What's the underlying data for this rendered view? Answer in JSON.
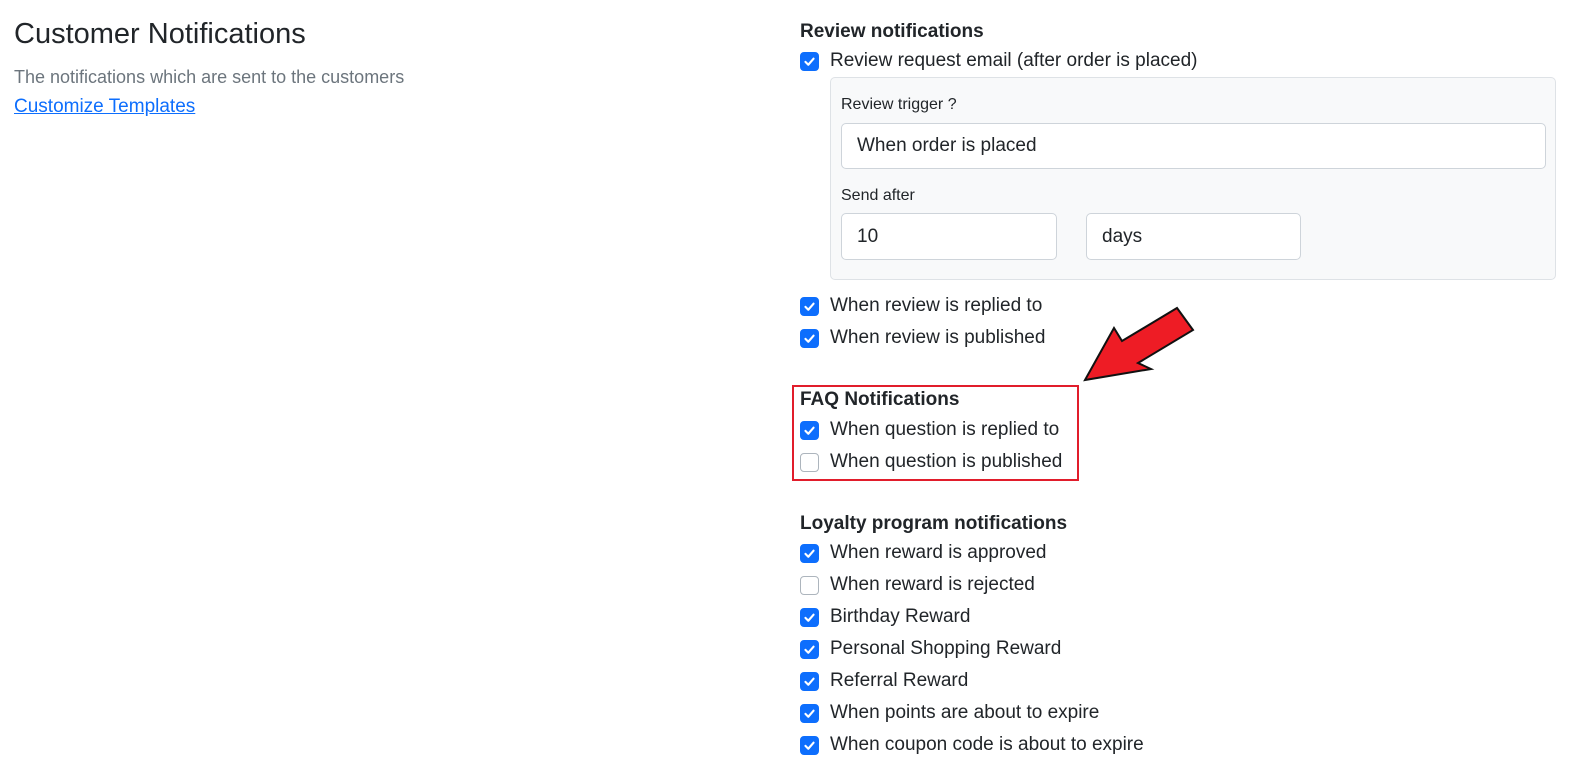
{
  "header": {
    "title": "Customer Notifications",
    "subtitle": "The notifications which are sent to the customers",
    "customize_link": "Customize Templates"
  },
  "review": {
    "heading": "Review notifications",
    "request_email": {
      "label": "Review request email (after order is placed)",
      "checked": true
    },
    "trigger_label": "Review trigger ?",
    "trigger_value": "When order is placed",
    "send_after_label": "Send after",
    "send_after_value": "10",
    "send_after_unit": "days",
    "items": [
      {
        "label": "When review is replied to",
        "checked": true
      },
      {
        "label": "When review is published",
        "checked": true
      }
    ]
  },
  "faq": {
    "heading": "FAQ Notifications",
    "items": [
      {
        "label": "When question is replied to",
        "checked": true
      },
      {
        "label": "When question is published",
        "checked": false
      }
    ]
  },
  "loyalty": {
    "heading": "Loyalty program notifications",
    "items": [
      {
        "label": "When reward is approved",
        "checked": true
      },
      {
        "label": "When reward is rejected",
        "checked": false
      },
      {
        "label": "Birthday Reward",
        "checked": true
      },
      {
        "label": "Personal Shopping Reward",
        "checked": true
      },
      {
        "label": "Referral Reward",
        "checked": true
      },
      {
        "label": "When points are about to expire",
        "checked": true
      },
      {
        "label": "When coupon code is about to expire",
        "checked": true
      }
    ]
  },
  "annotation": {
    "highlight_color": "#e11d2b",
    "arrow_color": "#ee1c25",
    "arrow_icon": "red-arrow-icon"
  },
  "colors": {
    "accent": "#0d6efd",
    "text": "#212529",
    "muted": "#6c757d"
  }
}
